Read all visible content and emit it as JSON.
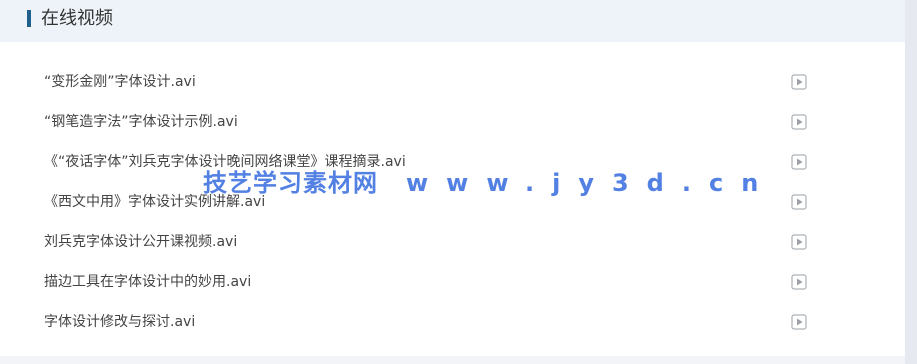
{
  "section": {
    "title": "在线视频"
  },
  "videos": [
    {
      "name": "“变形金刚”字体设计.avi"
    },
    {
      "name": "“钢笔造字法”字体设计示例.avi"
    },
    {
      "name": "《“夜话字体”刘兵克字体设计晚间网络课堂》课程摘录.avi"
    },
    {
      "name": "《西文中用》字体设计实例讲解.avi"
    },
    {
      "name": "刘兵克字体设计公开课视频.avi"
    },
    {
      "name": "描边工具在字体设计中的妙用.avi"
    },
    {
      "name": "字体设计修改与探讨.avi"
    }
  ],
  "icons": {
    "play": "play-icon"
  },
  "colors": {
    "accent_bar": "#1f5f8b",
    "header_bg": "#eef3f9",
    "watermark": "#3b6fe0"
  },
  "watermark": {
    "text_cn": "技艺学习素材网",
    "text_url": "www.jy3d.cn"
  }
}
